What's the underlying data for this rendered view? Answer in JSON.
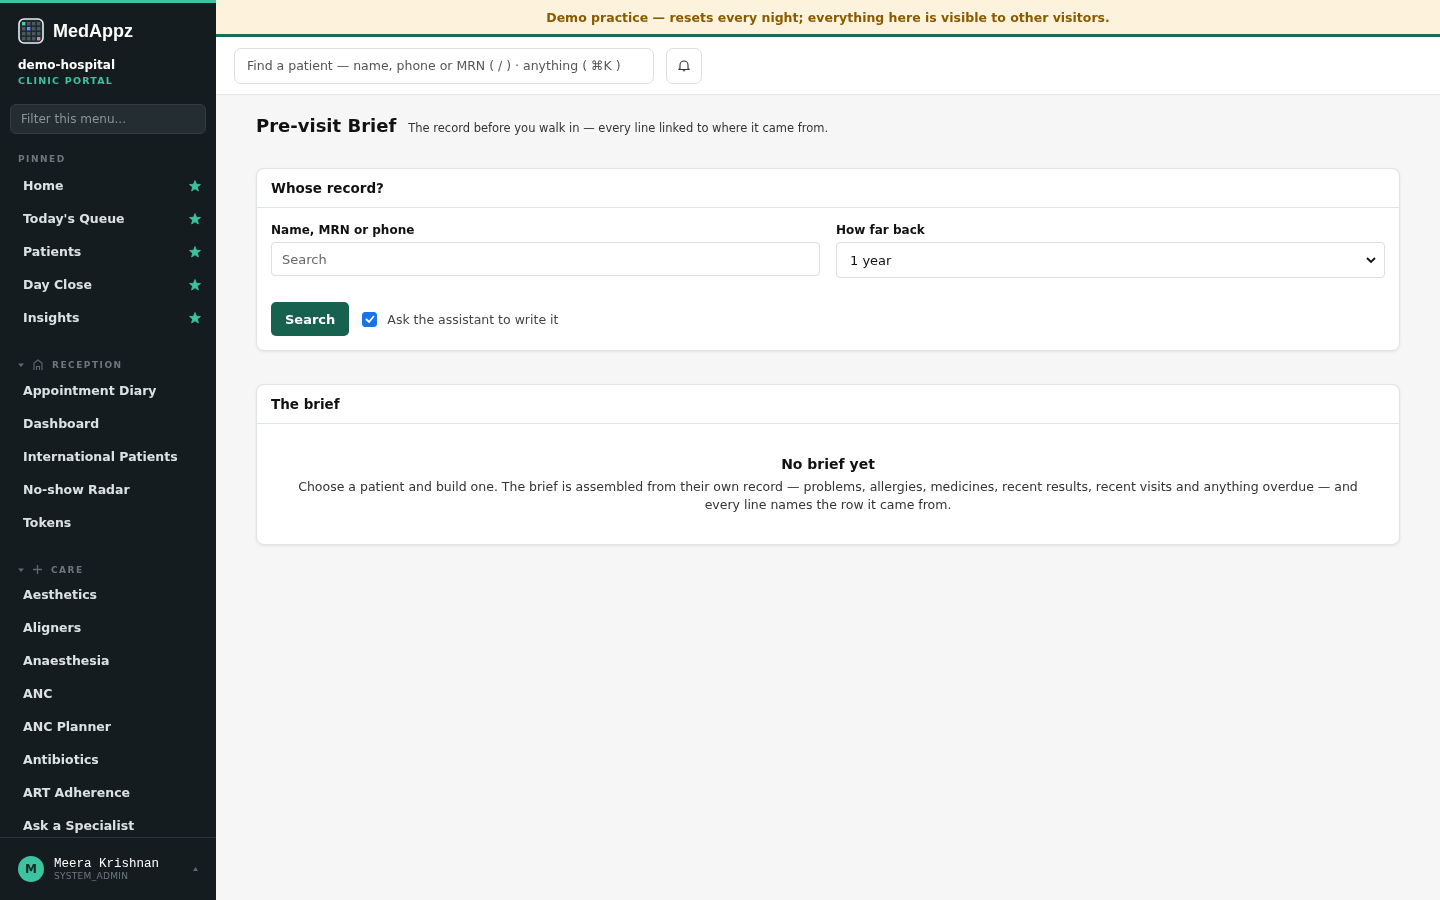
{
  "brand": {
    "name": "MedAppz",
    "org": "demo-hospital",
    "portal": "CLINIC PORTAL"
  },
  "sidebar": {
    "filter": {
      "placeholder": "Filter this menu..."
    },
    "pinned": {
      "label": "PINNED",
      "items": [
        {
          "label": "Home",
          "starred": true
        },
        {
          "label": "Today's Queue",
          "starred": true
        },
        {
          "label": "Patients",
          "starred": true
        },
        {
          "label": "Day Close",
          "starred": true
        },
        {
          "label": "Insights",
          "starred": true
        }
      ]
    },
    "sections": [
      {
        "label": "RECEPTION",
        "expanded": true,
        "items": [
          "Appointment Diary",
          "Dashboard",
          "International Patients",
          "No-show Radar",
          "Tokens"
        ]
      },
      {
        "label": "CARE",
        "expanded": true,
        "items": [
          "Aesthetics",
          "Aligners",
          "Anaesthesia",
          "ANC",
          "ANC Planner",
          "Antibiotics",
          "ART Adherence",
          "Ask a Specialist"
        ]
      }
    ],
    "user": {
      "initial": "M",
      "name": "Meera Krishnan",
      "role": "SYSTEM_ADMIN"
    }
  },
  "banner": "Demo practice — resets every night; everything here is visible to other visitors.",
  "topbar": {
    "search": {
      "placeholder": "Find a patient — name, phone or MRN ( / ) · anything ( ⌘K )"
    }
  },
  "page": {
    "title": "Pre-visit Brief",
    "subtitle": "The record before you walk in — every line linked to where it came from."
  },
  "record_card": {
    "title": "Whose record?",
    "name_label": "Name, MRN or phone",
    "name_placeholder": "Search",
    "range_label": "How far back",
    "range_value": "1 year",
    "button": "Search",
    "assistant": {
      "label": "Ask the assistant to write it",
      "checked": true
    }
  },
  "brief_card": {
    "title": "The brief",
    "empty_title": "No brief yet",
    "empty_text": "Choose a patient and build one. The brief is assembled from their own record — problems, allergies, medicines, recent results, recent visits and anything overdue — and every line names the row it came from."
  }
}
